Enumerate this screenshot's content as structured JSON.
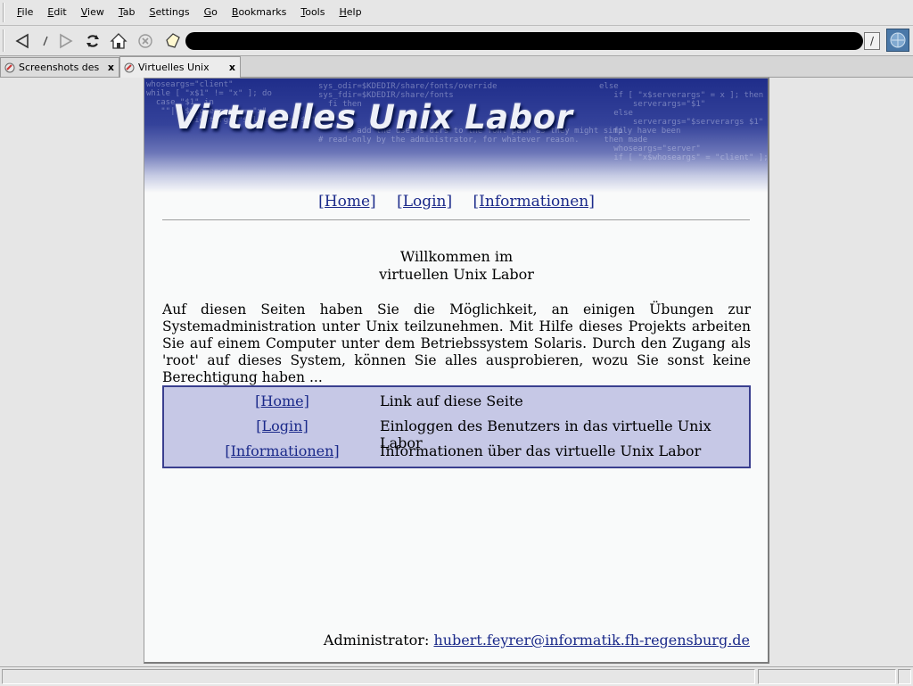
{
  "menu": [
    "File",
    "Edit",
    "View",
    "Tab",
    "Settings",
    "Go",
    "Bookmarks",
    "Tools",
    "Help"
  ],
  "menu_mnemonic": [
    "F",
    "E",
    "V",
    "T",
    "S",
    "G",
    "B",
    "T",
    "H"
  ],
  "toolbar": {
    "back_icon": "back-arrow-icon",
    "forward_icon": "forward-arrow-icon",
    "reload_icon": "reload-icon",
    "home_icon": "home-icon",
    "stop_icon": "stop-icon",
    "bookmark_icon": "bookmark-icon",
    "url_dropdown": "/"
  },
  "tabs": [
    {
      "label": "Screenshots des",
      "active": false
    },
    {
      "label": "Virtuelles Unix",
      "active": true
    }
  ],
  "banner": {
    "title": "Virtuelles Unix Labor"
  },
  "nav": {
    "home": "[Home]",
    "login": "[Login]",
    "info": "[Informationen]"
  },
  "welcome": {
    "line1": "Willkommen im",
    "line2": "virtuellen Unix Labor"
  },
  "intro": "Auf diesen Seiten haben Sie die Möglichkeit, an einigen Übungen zur Systemadministration unter Unix teilzunehmen. Mit Hilfe dieses Projekts arbeiten Sie auf einem Computer unter dem Betriebssystem Solaris. Durch den Zugang als 'root' auf dieses System, können Sie alles ausprobieren, wozu Sie sonst keine Berechtigung haben ...",
  "link_table": [
    {
      "link": "[Home]",
      "desc": "Link auf diese Seite"
    },
    {
      "link": "[Login]",
      "desc": "Einloggen des Benutzers in das virtuelle Unix Labor"
    },
    {
      "link": "[Informationen]",
      "desc": "Informationen über das virtuelle Unix Labor"
    }
  ],
  "admin": {
    "label": "Administrator:",
    "email": "hubert.feyrer@informatik.fh-regensburg.de"
  },
  "colors": {
    "link": "#1b2a8a",
    "table_bg": "#c6c8e6",
    "table_border": "#3a3f8f",
    "banner_dark": "#1f2d8a"
  }
}
